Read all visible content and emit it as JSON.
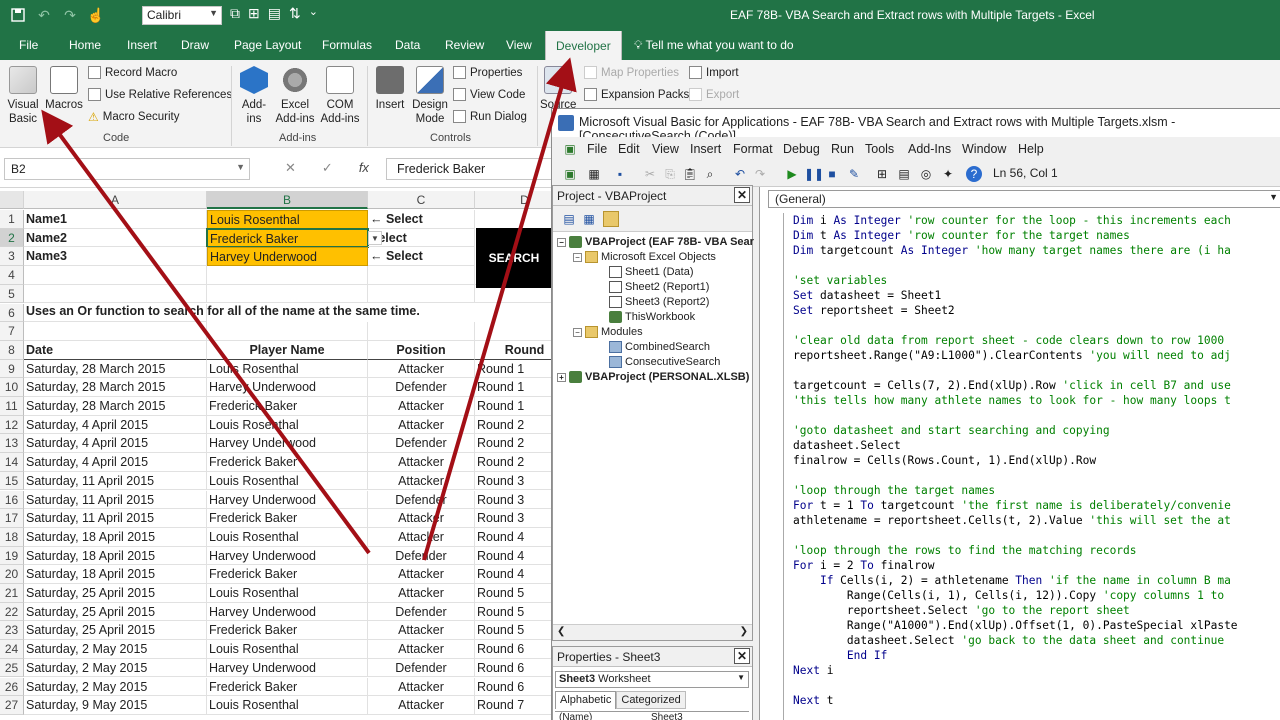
{
  "window": {
    "title": "EAF 78B- VBA Search and Extract rows with Multiple Targets  -  Excel"
  },
  "qat": {
    "font": "Calibri"
  },
  "tabs": [
    {
      "label": "File"
    },
    {
      "label": "Home"
    },
    {
      "label": "Insert"
    },
    {
      "label": "Draw"
    },
    {
      "label": "Page Layout"
    },
    {
      "label": "Formulas"
    },
    {
      "label": "Data"
    },
    {
      "label": "Review"
    },
    {
      "label": "View"
    },
    {
      "label": "Developer"
    }
  ],
  "tellme": "Tell me what you want to do",
  "ribbon": {
    "visual_basic": "Visual Basic",
    "macros": "Macros",
    "record_macro": "Record Macro",
    "relative_refs": "Use Relative References",
    "macro_security": "Macro Security",
    "code_group": "Code",
    "addins": "Add-ins",
    "excel_addins": "Excel Add-ins",
    "com_addins": "COM Add-ins",
    "addins_group": "Add-ins",
    "insert": "Insert",
    "design_mode": "Design Mode",
    "properties": "Properties",
    "view_code": "View Code",
    "run_dialog": "Run Dialog",
    "controls_group": "Controls",
    "source": "Source",
    "map_properties": "Map Properties",
    "expansion_packs": "Expansion Packs",
    "import": "Import",
    "export": "Export"
  },
  "formula_bar": {
    "name_box": "B2",
    "value": "Frederick Baker"
  },
  "sheet": {
    "columns": [
      "A",
      "B",
      "C",
      "D"
    ],
    "names": [
      {
        "label": "Name1",
        "value": "Louis Rosenthal",
        "select": "← Select"
      },
      {
        "label": "Name2",
        "value": "Frederick Baker",
        "select": "Select"
      },
      {
        "label": "Name3",
        "value": "Harvey Underwood",
        "select": "← Select"
      }
    ],
    "search_button": "SEARCH",
    "hint": "Uses an Or function to search for all of the name at the same time.",
    "headers": [
      "Date",
      "Player Name",
      "Position",
      "Round"
    ],
    "row_numbers": [
      "1",
      "2",
      "3",
      "4",
      "5",
      "6",
      "7",
      "8",
      "9",
      "10",
      "11",
      "12",
      "13",
      "14",
      "15",
      "16",
      "17",
      "18",
      "19",
      "20",
      "21",
      "22",
      "23",
      "24",
      "25",
      "26",
      "27"
    ],
    "rows": [
      [
        "Saturday, 28 March 2015",
        "Louis Rosenthal",
        "Attacker",
        "Round 1"
      ],
      [
        "Saturday, 28 March 2015",
        "Harvey Underwood",
        "Defender",
        "Round 1"
      ],
      [
        "Saturday, 28 March 2015",
        "Frederick Baker",
        "Attacker",
        "Round 1"
      ],
      [
        "Saturday, 4 April 2015",
        "Louis Rosenthal",
        "Attacker",
        "Round 2"
      ],
      [
        "Saturday, 4 April 2015",
        "Harvey Underwood",
        "Defender",
        "Round 2"
      ],
      [
        "Saturday, 4 April 2015",
        "Frederick Baker",
        "Attacker",
        "Round 2"
      ],
      [
        "Saturday, 11 April 2015",
        "Louis Rosenthal",
        "Attacker",
        "Round 3"
      ],
      [
        "Saturday, 11 April 2015",
        "Harvey Underwood",
        "Defender",
        "Round 3"
      ],
      [
        "Saturday, 11 April 2015",
        "Frederick Baker",
        "Attacker",
        "Round 3"
      ],
      [
        "Saturday, 18 April 2015",
        "Louis Rosenthal",
        "Attacker",
        "Round 4"
      ],
      [
        "Saturday, 18 April 2015",
        "Harvey Underwood",
        "Defender",
        "Round 4"
      ],
      [
        "Saturday, 18 April 2015",
        "Frederick Baker",
        "Attacker",
        "Round 4"
      ],
      [
        "Saturday, 25 April 2015",
        "Louis Rosenthal",
        "Attacker",
        "Round 5"
      ],
      [
        "Saturday, 25 April 2015",
        "Harvey Underwood",
        "Defender",
        "Round 5"
      ],
      [
        "Saturday, 25 April 2015",
        "Frederick Baker",
        "Attacker",
        "Round 5"
      ],
      [
        "Saturday, 2 May 2015",
        "Louis Rosenthal",
        "Attacker",
        "Round 6"
      ],
      [
        "Saturday, 2 May 2015",
        "Harvey Underwood",
        "Defender",
        "Round 6"
      ],
      [
        "Saturday, 2 May 2015",
        "Frederick Baker",
        "Attacker",
        "Round 6"
      ],
      [
        "Saturday, 9 May 2015",
        "Louis Rosenthal",
        "Attacker",
        "Round 7"
      ]
    ]
  },
  "vba": {
    "title": "Microsoft Visual Basic for Applications - EAF 78B- VBA Search and Extract rows with Multiple Targets.xlsm - [ConsecutiveSearch (Code)]",
    "menu": [
      "File",
      "Edit",
      "View",
      "Insert",
      "Format",
      "Debug",
      "Run",
      "Tools",
      "Add-Ins",
      "Window",
      "Help"
    ],
    "position": "Ln 56, Col 1",
    "project_title": "Project - VBAProject",
    "tree": [
      "VBAProject (EAF 78B- VBA Sear",
      "Microsoft Excel Objects",
      "Sheet1 (Data)",
      "Sheet2 (Report1)",
      "Sheet3 (Report2)",
      "ThisWorkbook",
      "Modules",
      "CombinedSearch",
      "ConsecutiveSearch",
      "VBAProject (PERSONAL.XLSB)"
    ],
    "props_title": "Properties - Sheet3",
    "props_object": "Sheet3",
    "props_object_type": "Worksheet",
    "props_tabs": [
      "Alphabetic",
      "Categorized"
    ],
    "props_row": [
      "(Name)",
      "Sheet3"
    ],
    "proc_dropdown": "(General)",
    "code_lines": [
      {
        "k": "Dim",
        "t": " i ",
        "k2": "As Integer",
        "c": " 'row counter for the loop - this increments each"
      },
      {
        "k": "Dim",
        "t": " t ",
        "k2": "As Integer",
        "c": " 'row counter for the target names"
      },
      {
        "k": "Dim",
        "t": " targetcount ",
        "k2": "As Integer",
        "c": " 'how many target names there are (i ha"
      },
      {
        "t": ""
      },
      {
        "c": "'set variables"
      },
      {
        "k": "Set",
        "t": " datasheet = Sheet1"
      },
      {
        "k": "Set",
        "t": " reportsheet = Sheet2"
      },
      {
        "t": ""
      },
      {
        "c": "'clear old data from report sheet - code clears down to row 1000"
      },
      {
        "t": "reportsheet.Range(\"A9:L1000\").ClearContents",
        "c": " 'you will need to adj"
      },
      {
        "t": ""
      },
      {
        "t": "targetcount = Cells(7, 2).End(xlUp).Row",
        "c": " 'click in cell B7 and use"
      },
      {
        "c": "'this tells how many athlete names to look for - how many loops t"
      },
      {
        "t": ""
      },
      {
        "c": "'goto datasheet and start searching and copying"
      },
      {
        "t": "datasheet.Select"
      },
      {
        "t": "finalrow = Cells(Rows.Count, 1).End(xlUp).Row"
      },
      {
        "t": ""
      },
      {
        "c": "'loop through the target names"
      },
      {
        "k": "For",
        "t": " t = 1 ",
        "k2": "To",
        "t2": " targetcount",
        "c": " 'the first name is deliberately/convenie"
      },
      {
        "t": "athletename = reportsheet.Cells(t, 2).Value",
        "c": " 'this will set the at"
      },
      {
        "t": ""
      },
      {
        "c": "'loop through the rows to find the matching records"
      },
      {
        "k": "For",
        "t": " i = 2 ",
        "k2": "To",
        "t2": " finalrow"
      },
      {
        "i": "    ",
        "k": "If",
        "t": " Cells(i, 2) = athletename ",
        "k2": "Then",
        "c": " 'if the name in column B ma"
      },
      {
        "i": "        ",
        "t": "Range(Cells(i, 1), Cells(i, 12)).Copy",
        "c": " 'copy columns 1 to"
      },
      {
        "i": "        ",
        "t": "reportsheet.Select",
        "c": " 'go to the report sheet"
      },
      {
        "i": "        ",
        "t": "Range(\"A1000\").End(xlUp).Offset(1, 0).PasteSpecial xlPaste"
      },
      {
        "i": "        ",
        "t": "datasheet.Select",
        "c": " 'go back to the data sheet and continue"
      },
      {
        "i": "        ",
        "k": "End If"
      },
      {
        "k": "Next",
        "t": " i"
      },
      {
        "t": ""
      },
      {
        "k": "Next",
        "t": " t"
      }
    ]
  },
  "colors": {
    "excel_green": "#217346",
    "highlight": "#ffc000",
    "arrow": "#a30f16"
  }
}
